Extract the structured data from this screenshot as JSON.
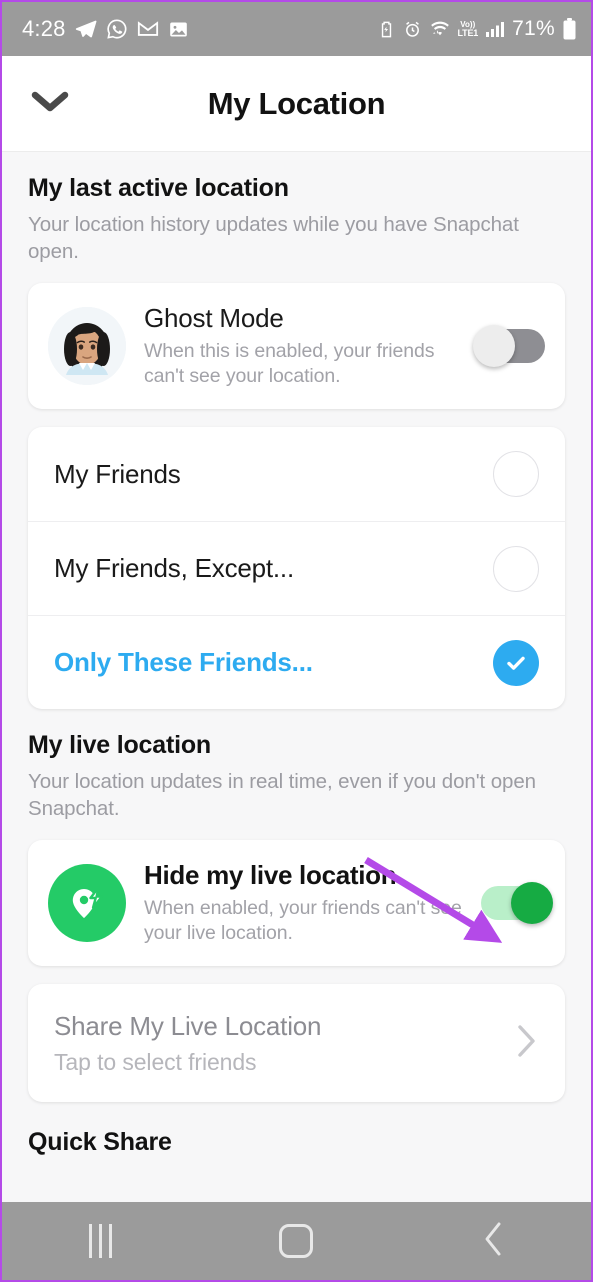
{
  "statusbar": {
    "time": "4:28",
    "left_icons": [
      "telegram-icon",
      "whatsapp-icon",
      "gmail-icon",
      "gallery-icon"
    ],
    "right_icons": [
      "battery-saver-icon",
      "alarm-icon",
      "wifi-icon",
      "volte-icon",
      "signal-icon"
    ],
    "volte_top": "Vo))",
    "volte_bottom": "LTE1",
    "battery_percent": "71%"
  },
  "header": {
    "back_icon": "chevron-down-icon",
    "title": "My Location"
  },
  "last_active": {
    "title": "My last active location",
    "subtitle": "Your location history updates while you have Snapchat open.",
    "ghost_mode": {
      "avatar": "bitmoji-avatar",
      "title": "Ghost Mode",
      "description": "When this is enabled, your friends can't see your location.",
      "toggle_state": "off"
    },
    "options": [
      {
        "label": "My Friends",
        "selected": false
      },
      {
        "label": "My Friends, Except...",
        "selected": false
      },
      {
        "label": "Only These Friends...",
        "selected": true
      }
    ]
  },
  "live_location": {
    "title": "My live location",
    "subtitle": "Your location updates in real time, even if you don't open Snapchat.",
    "hide": {
      "icon": "live-location-pin-bolt-icon",
      "title": "Hide my live location",
      "description": "When enabled, your friends can't see your live location.",
      "toggle_state": "on"
    },
    "share": {
      "title": "Share My Live Location",
      "subtitle": "Tap to select friends",
      "chevron": "chevron-right-icon"
    }
  },
  "quick_share": {
    "title": "Quick Share"
  },
  "navbar": {
    "recents": "recents-button",
    "home": "home-button",
    "back": "back-button"
  },
  "annotation": {
    "arrow": "purple-arrow-pointing-to-hide-live-location-toggle"
  },
  "colors": {
    "accent_blue": "#2dabf0",
    "accent_green": "#24cb67",
    "toggle_on_track": "#b9efc9",
    "toggle_on_knob": "#16ab43",
    "toggle_off_track": "#8e8e93",
    "annotation_purple": "#b44ae8",
    "background": "#f7f7f8",
    "statusbar": "#9b9b9b"
  }
}
